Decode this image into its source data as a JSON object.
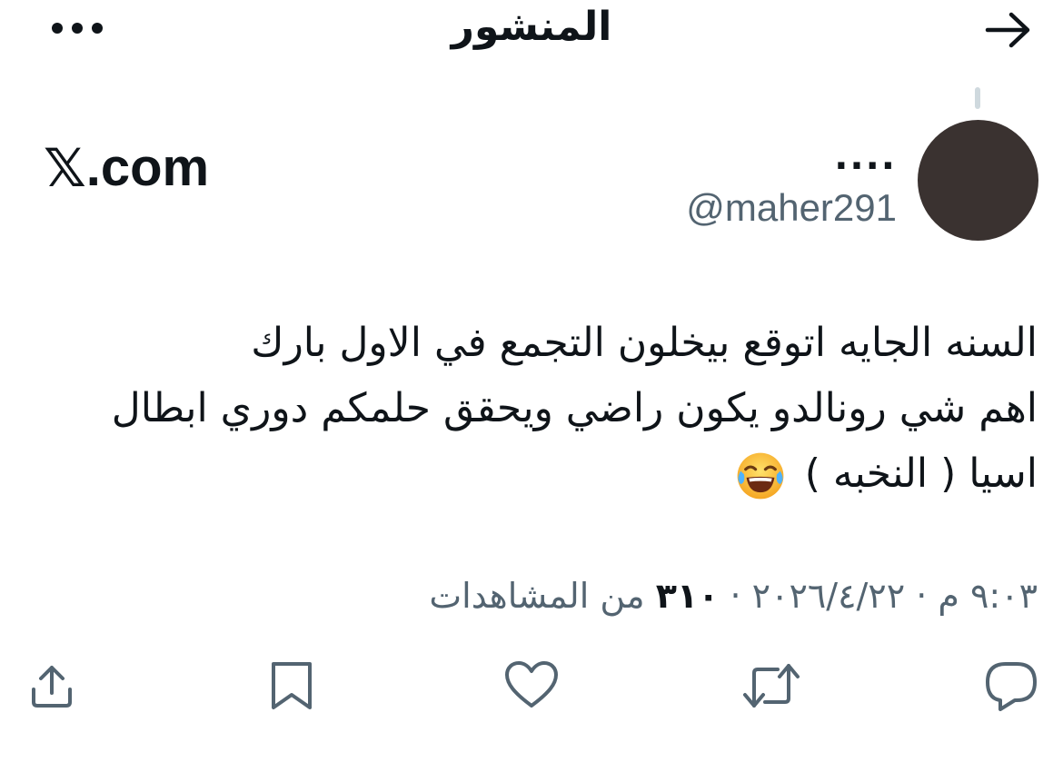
{
  "header": {
    "title": "المنشور",
    "back_icon": "arrow-right-icon",
    "more_icon": "more-dots-icon"
  },
  "author": {
    "display_name": "....",
    "handle": "@maher291",
    "avatar_color": "#3a3230"
  },
  "brand": {
    "text": ".com",
    "mark": "𝕏"
  },
  "post": {
    "lines": [
      "السنه الجايه اتوقع بيخلون التجمع في الاول بارك",
      "اهم شي رونالدو يكون راضي ويحقق حلمكم دوري ابطال",
      "اسيا ( النخبه )"
    ],
    "emoji_icon": "tears-of-joy-emoji"
  },
  "meta": {
    "datetime": "٩:٠٣ م · ٢٠٢٦/٤/٢٢",
    "separator": "·",
    "views_count": "٣١٠",
    "views_label": "من المشاهدات"
  },
  "actions": {
    "reply_icon": "reply-icon",
    "retweet_icon": "retweet-icon",
    "like_icon": "heart-icon",
    "bookmark_icon": "bookmark-icon",
    "share_icon": "share-icon"
  },
  "colors": {
    "text_primary": "#0f1419",
    "text_secondary": "#536471",
    "thread_line": "#cfd9de",
    "background": "#ffffff"
  }
}
